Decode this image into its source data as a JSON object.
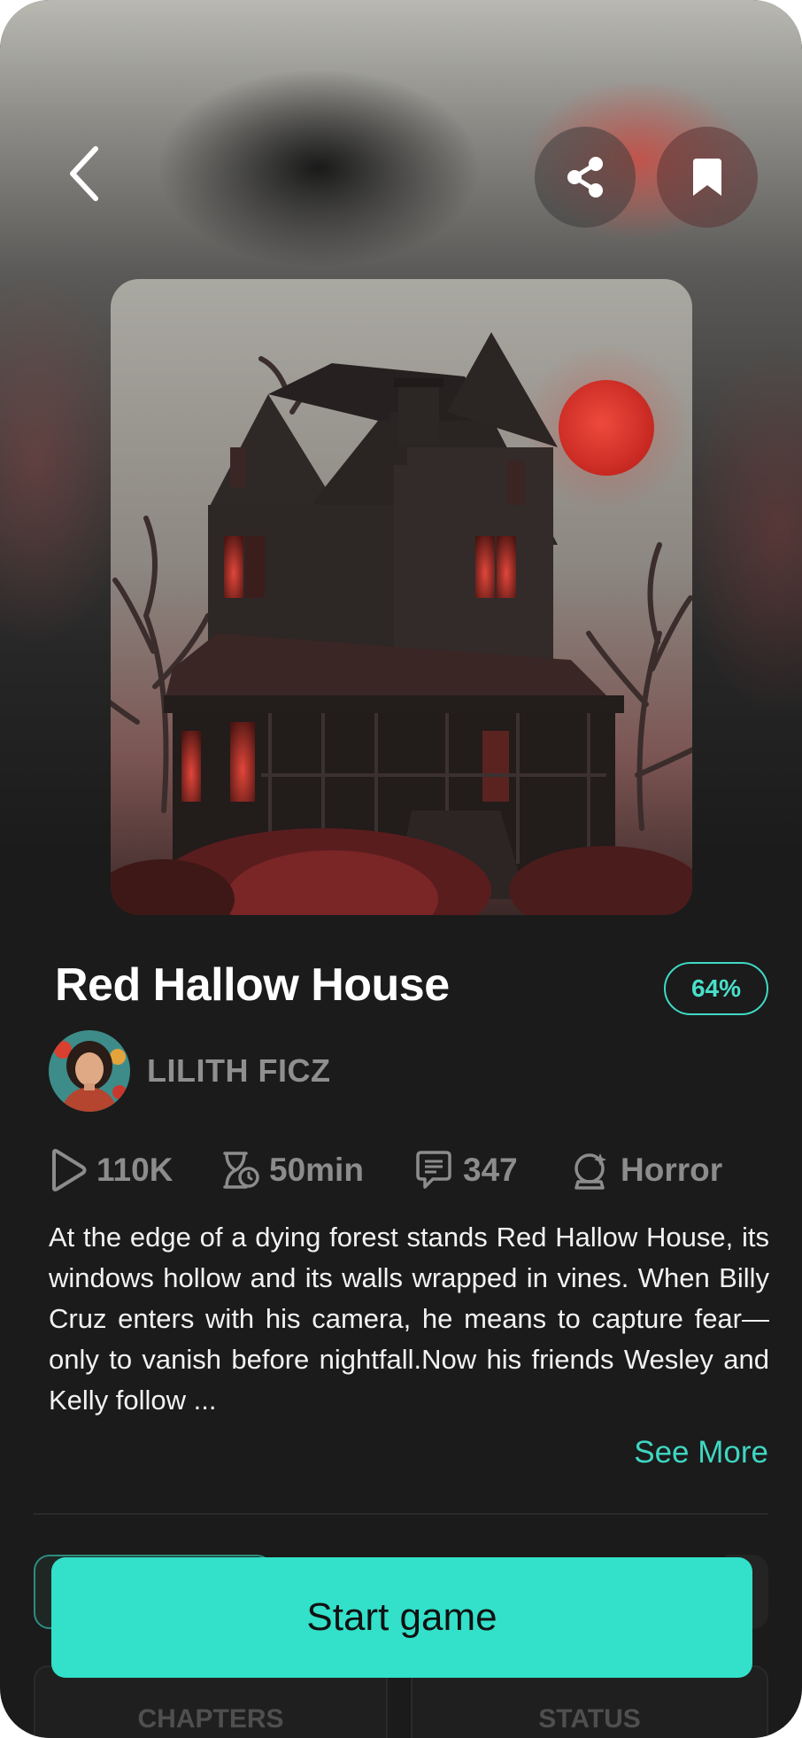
{
  "header": {
    "back_icon": "chevron-left-icon",
    "share_icon": "share-icon",
    "bookmark_icon": "bookmark-icon"
  },
  "story": {
    "title": "Red Hallow House",
    "progress": "64%",
    "author": "LILITH FICZ",
    "stats": {
      "plays": "110K",
      "duration": "50min",
      "comments": "347",
      "genre": "Horror"
    },
    "description": "At the edge of a dying forest stands Red Hallow House, its windows hollow and its walls wrapped in vines. When Billy Cruz enters with his camera, he means to capture fear—only to vanish before nightfall.Now his friends Wesley and Kelly follow ...",
    "see_more": "See More"
  },
  "actions": {
    "start_label": "Start game"
  },
  "tabs": [
    {
      "label": "CHAPTERS"
    },
    {
      "label": "STATUS"
    }
  ],
  "colors": {
    "accent": "#33e0c9",
    "background": "#1b1b1b",
    "moon": "#d9322b"
  }
}
